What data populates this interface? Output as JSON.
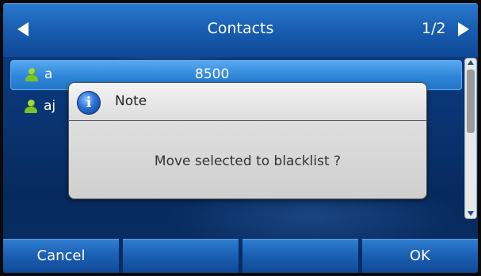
{
  "header": {
    "title": "Contacts",
    "page_indicator": "1/2"
  },
  "contacts": [
    {
      "name": "a",
      "number": "8500",
      "selected": true
    },
    {
      "name": "aj",
      "number": "",
      "selected": false
    }
  ],
  "dialog": {
    "title": "Note",
    "message": "Move selected to blacklist ?"
  },
  "softkeys": [
    "Cancel",
    "",
    "",
    "OK"
  ],
  "colors": {
    "header_blue": "#1a5fb3",
    "selected_row": "#2f86d8",
    "contact_icon_green": "#7cc224",
    "dialog_bg": "#dcdcdc"
  }
}
